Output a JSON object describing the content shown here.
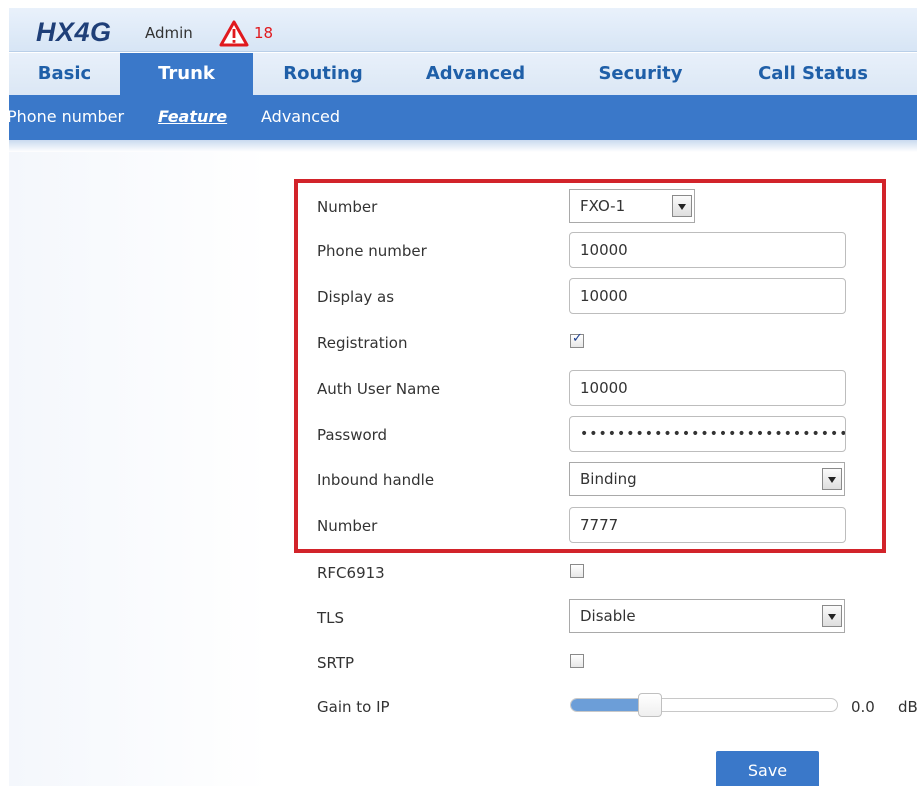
{
  "header": {
    "brand": "HX4G",
    "role": "Admin",
    "alarm_icon": "warning-triangle-icon",
    "alarm_count": "18"
  },
  "main_nav": [
    {
      "label": "Basic"
    },
    {
      "label": "Trunk",
      "active": true
    },
    {
      "label": "Routing"
    },
    {
      "label": "Advanced"
    },
    {
      "label": "Security"
    },
    {
      "label": "Call Status"
    }
  ],
  "sub_nav": [
    {
      "label": "Phone number"
    },
    {
      "label": "Feature",
      "active": true
    },
    {
      "label": "Advanced"
    }
  ],
  "form": {
    "number": {
      "label": "Number",
      "value": "FXO-1"
    },
    "phone_number": {
      "label": "Phone number",
      "value": "10000"
    },
    "display_as": {
      "label": "Display as",
      "value": "10000"
    },
    "registration": {
      "label": "Registration",
      "checked": true
    },
    "auth_user_name": {
      "label": "Auth User Name",
      "value": "10000"
    },
    "password": {
      "label": "Password",
      "value": "••••••••••••••••••••••••••••••"
    },
    "inbound_handle": {
      "label": "Inbound handle",
      "value": "Binding"
    },
    "bound_number": {
      "label": "Number",
      "value": "7777"
    },
    "rfc6913": {
      "label": "RFC6913",
      "checked": false
    },
    "tls": {
      "label": "TLS",
      "value": "Disable"
    },
    "srtp": {
      "label": "SRTP",
      "checked": false
    },
    "gain_to_ip": {
      "label": "Gain to IP",
      "value": "0.0",
      "unit": "dB",
      "level": 0.25
    }
  },
  "actions": {
    "save_label": "Save"
  },
  "colors": {
    "accent": "#3a78c9",
    "brand": "#1f3f78",
    "alarm": "#e0191e",
    "highlight": "#d2232a"
  }
}
